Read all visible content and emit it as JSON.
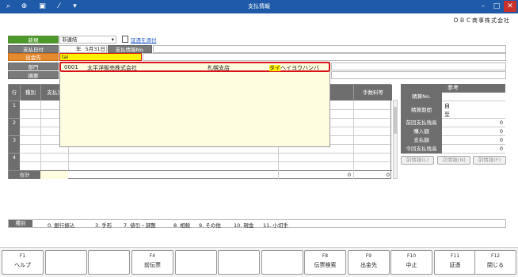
{
  "window": {
    "title": "支払情報",
    "company": "ＯＢＣ商事株式会社"
  },
  "toolbar": {
    "icons": [
      "key-search-icon",
      "zoom-icon",
      "print-icon",
      "chart-icon",
      "menu-dropdown-icon"
    ]
  },
  "form": {
    "new_label": "新規",
    "new_select_value": "非連結",
    "attach_link": "証憑を添付",
    "pay_date_label": "支払日付",
    "pay_date_year": "年",
    "pay_date_value": "5月31日",
    "pay_info_no_label": "支払情報No.",
    "payee_label": "出金先",
    "payee_input": "tai",
    "dept_label": "部門",
    "memo_label": "摘要"
  },
  "popup": {
    "rows": [
      {
        "code": "0001",
        "name": "太平洋販売株式会社",
        "branch": "札幌支店",
        "kana_hl": "タイ",
        "kana_rest": "ヘイヨウハンバ"
      }
    ]
  },
  "grid": {
    "col_row": "行",
    "col_type": "種別",
    "col_payer": "支払方",
    "col_fee": "手数料等",
    "rows": [
      "1",
      "2",
      "3",
      "4"
    ],
    "total_label": "合計",
    "total_amount": "0",
    "total_fee": "0"
  },
  "reference": {
    "title": "参考",
    "seisan_no": "精算No.",
    "seisan_period": "精算期間",
    "from": "自",
    "to": "至",
    "prev_balance": "前回支払残高",
    "purchase": "購入額",
    "paid": "支払額",
    "this_balance": "今回支払残高",
    "values": [
      "0",
      "0",
      "0",
      "0"
    ],
    "btn_prev": "前情報(L)",
    "btn_next": "次情報(N)",
    "btn_del": "前情報(F)"
  },
  "legend": {
    "label": "種別",
    "items": [
      "0. 銀行振込",
      "3. 手形",
      "7. 値引・調整",
      "8. 相殺",
      "9. その他",
      "10. 現金",
      "11. 小切手"
    ]
  },
  "fkeys": [
    {
      "key": "F1",
      "name": "ヘルプ"
    },
    {
      "key": "",
      "name": ""
    },
    {
      "key": "",
      "name": ""
    },
    {
      "key": "F4",
      "name": "前伝票"
    },
    {
      "key": "",
      "name": ""
    },
    {
      "key": "",
      "name": ""
    },
    {
      "key": "",
      "name": ""
    },
    {
      "key": "F8",
      "name": "伝票検索"
    },
    {
      "key": "F9",
      "name": "出金先"
    },
    {
      "key": "F10",
      "name": "中止"
    },
    {
      "key": "F11",
      "name": "証憑"
    },
    {
      "key": "F12",
      "name": "閉じる"
    }
  ]
}
